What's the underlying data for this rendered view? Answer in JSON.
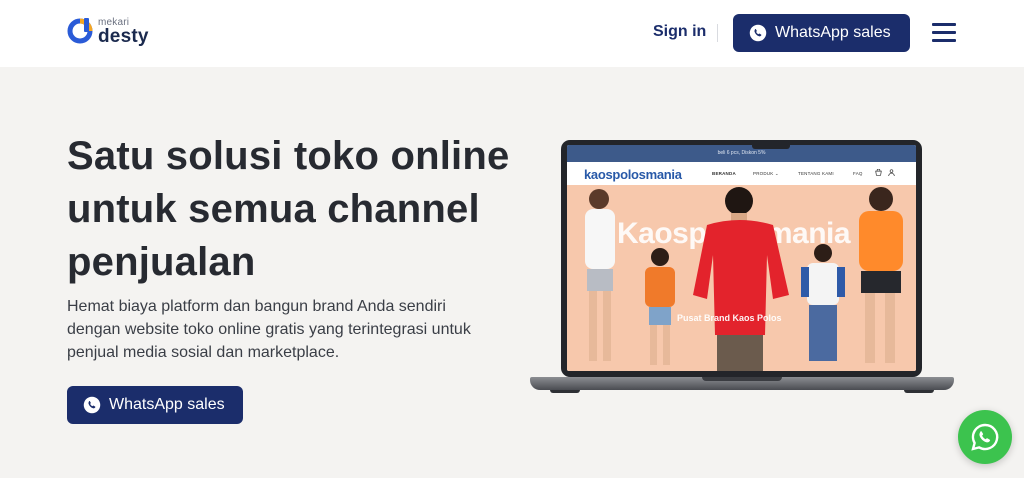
{
  "brand": {
    "top_word": "mekari",
    "name": "desty"
  },
  "header": {
    "signin_label": "Sign in",
    "whatsapp_label": "WhatsApp sales",
    "menu_icon": "hamburger-menu-icon"
  },
  "hero": {
    "title": "Satu solusi toko online untuk semua channel penjualan",
    "description": "Hemat biaya platform dan bangun brand Anda sendiri dengan website toko online gratis yang terintegrasi untuk penjual media sosial dan marketplace.",
    "whatsapp_label": "WhatsApp sales"
  },
  "laptop_site": {
    "announcement": "beli 6 pcs, Diskon 5%",
    "logo": "kaospolosmania",
    "nav": [
      "BERANDA",
      "PRODUK ⌄",
      "TENTANG KAMI",
      "FAQ"
    ],
    "banner_word": "Kaospolosmania",
    "banner_sub": "Pusat Brand Kaos Polos"
  },
  "colors": {
    "primary": "#1b2d6b",
    "hero_bg": "#f4f3f1",
    "whatsapp_green": "#3cc34e",
    "brand_orange": "#f5a623",
    "brand_blue": "#2a5bd7"
  }
}
